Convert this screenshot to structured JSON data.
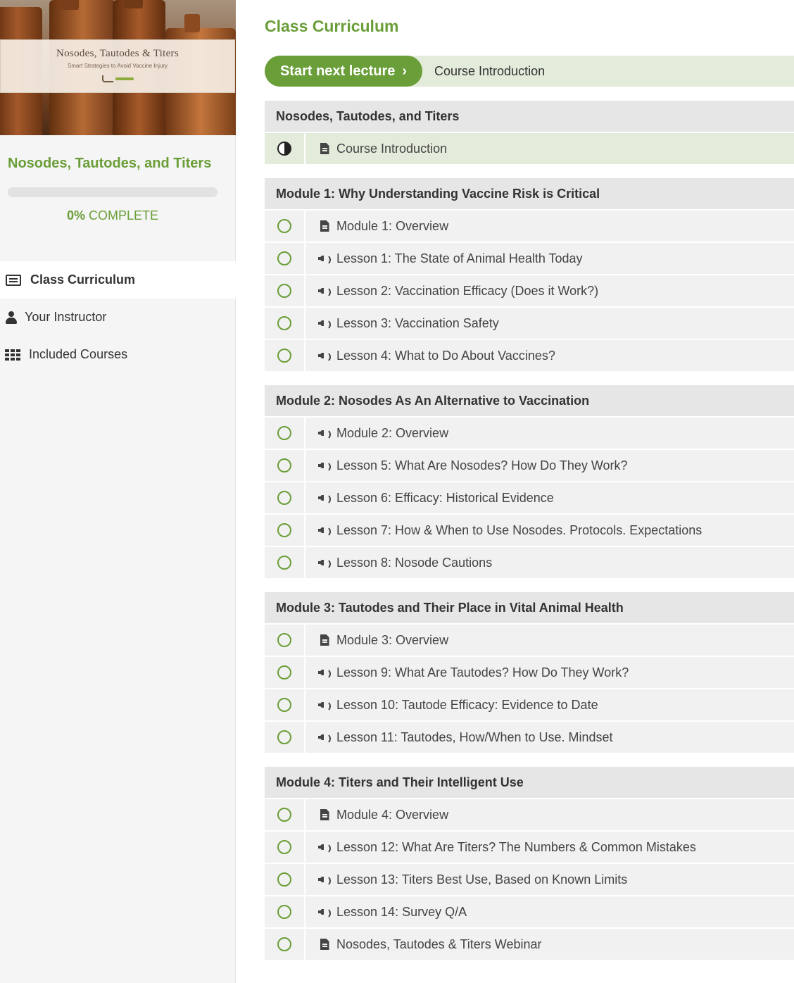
{
  "sidebar": {
    "cover": {
      "title": "Nosodes, Tautodes & Titers",
      "subtitle": "Smart Strategies to Avoid Vaccine Injury"
    },
    "course_title": "Nosodes, Tautodes, and Titers",
    "progress": {
      "value_percent": 0,
      "percent_label": "0%",
      "complete_label": "COMPLETE"
    },
    "nav": [
      {
        "label": "Class Curriculum",
        "icon": "list-icon",
        "active": true
      },
      {
        "label": "Your Instructor",
        "icon": "user-icon",
        "active": false
      },
      {
        "label": "Included Courses",
        "icon": "grid-icon",
        "active": false
      }
    ]
  },
  "main": {
    "title": "Class Curriculum",
    "next_button": "Start next lecture",
    "next_lecture": "Course Introduction",
    "sections": [
      {
        "title": "Nosodes, Tautodes, and Titers",
        "items": [
          {
            "label": "Course Introduction",
            "type": "document",
            "status": "in-progress"
          }
        ]
      },
      {
        "title": "Module 1: Why Understanding Vaccine Risk is Critical",
        "items": [
          {
            "label": "Module 1: Overview",
            "type": "document",
            "status": "incomplete"
          },
          {
            "label": "Lesson 1: The State of Animal Health Today",
            "type": "audio",
            "status": "incomplete"
          },
          {
            "label": "Lesson 2: Vaccination Efficacy (Does it Work?)",
            "type": "audio",
            "status": "incomplete"
          },
          {
            "label": "Lesson 3: Vaccination Safety",
            "type": "audio",
            "status": "incomplete"
          },
          {
            "label": "Lesson 4: What to Do About Vaccines?",
            "type": "audio",
            "status": "incomplete"
          }
        ]
      },
      {
        "title": "Module 2: Nosodes As An Alternative to Vaccination",
        "items": [
          {
            "label": "Module 2: Overview",
            "type": "audio",
            "status": "incomplete"
          },
          {
            "label": "Lesson 5: What Are Nosodes? How Do They Work?",
            "type": "audio",
            "status": "incomplete"
          },
          {
            "label": "Lesson 6: Efficacy: Historical Evidence",
            "type": "audio",
            "status": "incomplete"
          },
          {
            "label": "Lesson 7: How & When to Use Nosodes. Protocols. Expectations",
            "type": "audio",
            "status": "incomplete"
          },
          {
            "label": "Lesson 8: Nosode Cautions",
            "type": "audio",
            "status": "incomplete"
          }
        ]
      },
      {
        "title": "Module 3: Tautodes and Their Place in Vital Animal Health",
        "items": [
          {
            "label": "Module 3: Overview",
            "type": "document",
            "status": "incomplete"
          },
          {
            "label": "Lesson 9: What Are Tautodes? How Do They Work?",
            "type": "audio",
            "status": "incomplete"
          },
          {
            "label": "Lesson 10: Tautode Efficacy: Evidence to Date",
            "type": "audio",
            "status": "incomplete"
          },
          {
            "label": "Lesson 11: Tautodes, How/When to Use. Mindset",
            "type": "audio",
            "status": "incomplete"
          }
        ]
      },
      {
        "title": "Module 4: Titers and Their Intelligent Use",
        "items": [
          {
            "label": "Module 4: Overview",
            "type": "document",
            "status": "incomplete"
          },
          {
            "label": "Lesson 12: What Are Titers? The Numbers & Common Mistakes",
            "type": "audio",
            "status": "incomplete"
          },
          {
            "label": "Lesson 13: Titers Best Use, Based on Known Limits",
            "type": "audio",
            "status": "incomplete"
          },
          {
            "label": "Lesson 14: Survey Q/A",
            "type": "audio",
            "status": "incomplete"
          },
          {
            "label": "Nosodes, Tautodes & Titers Webinar",
            "type": "document",
            "status": "incomplete"
          }
        ]
      }
    ]
  },
  "colors": {
    "accent": "#6a9e38",
    "highlight_bg": "#e3ebdb",
    "section_bg": "#e6e6e6",
    "item_bg": "#f1f1f1",
    "sidebar_bg": "#f5f5f5"
  }
}
